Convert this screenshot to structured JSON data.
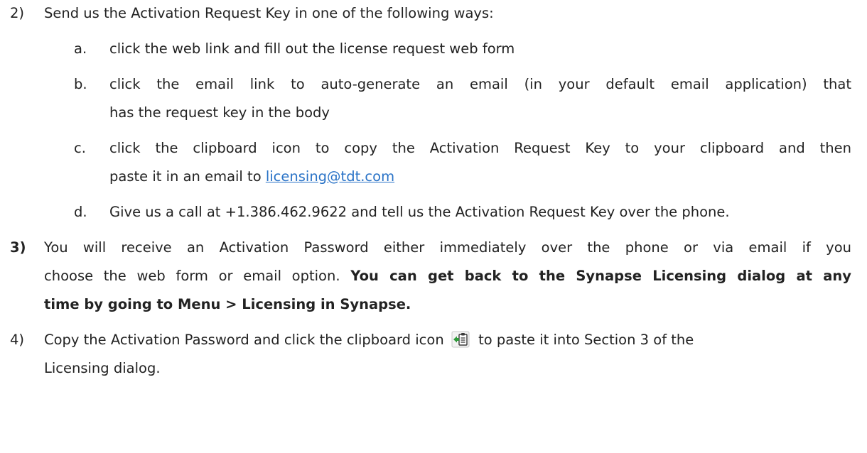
{
  "steps": {
    "step2": {
      "number": "2)",
      "text": "Send us the Activation Request Key in one of the following ways:",
      "items": {
        "a": {
          "letter": "a.",
          "text": "click the web link and fill out the license request web form"
        },
        "b": {
          "letter": "b.",
          "line1": "click the email link to auto-generate an email (in your default email application) that",
          "line2": "has the request key in the body"
        },
        "c": {
          "letter": "c.",
          "line1": "click the clipboard icon to copy the Activation Request Key to your clipboard and then",
          "line2_prefix": "paste it in an email to ",
          "email_link": "licensing@tdt.com"
        },
        "d": {
          "letter": "d.",
          "text": "Give us a call at +1.386.462.9622 and tell us the Activation Request Key over the phone."
        }
      }
    },
    "step3": {
      "number": "3)",
      "line1": "You will receive an Activation Password either immediately over the phone or via email if you",
      "line2_prefix": "choose the web form or email option. ",
      "line2_bold": "You can get back to the Synapse Licensing dialog at any",
      "line3_bold": "time by going to Menu > Licensing in Synapse."
    },
    "step4": {
      "number": "4)",
      "line1_prefix": "Copy the Activation Password and click the clipboard icon",
      "line1_suffix": "to paste it into Section 3 of the",
      "line2": "Licensing dialog.",
      "icon": "clipboard-paste-icon"
    }
  }
}
